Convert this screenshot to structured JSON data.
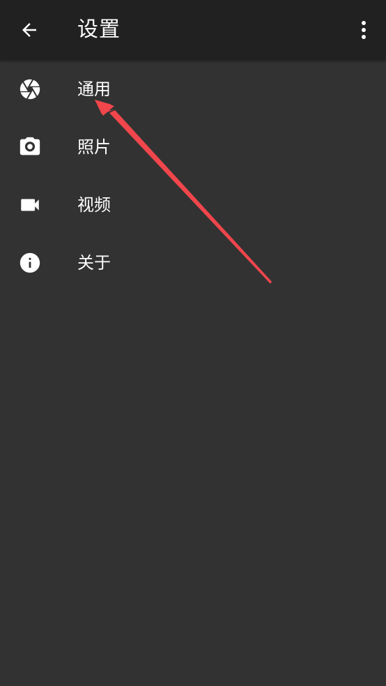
{
  "header": {
    "title": "设置",
    "back_icon": "arrow-back-icon",
    "more_icon": "more-vert-icon"
  },
  "settings": {
    "items": [
      {
        "label": "通用",
        "icon": "aperture-icon"
      },
      {
        "label": "照片",
        "icon": "camera-icon"
      },
      {
        "label": "视频",
        "icon": "videocam-icon"
      },
      {
        "label": "关于",
        "icon": "info-icon"
      }
    ]
  },
  "colors": {
    "background": "#323232",
    "app_bar": "#212121",
    "text": "#ffffff",
    "annotation_arrow": "#f0464c"
  }
}
